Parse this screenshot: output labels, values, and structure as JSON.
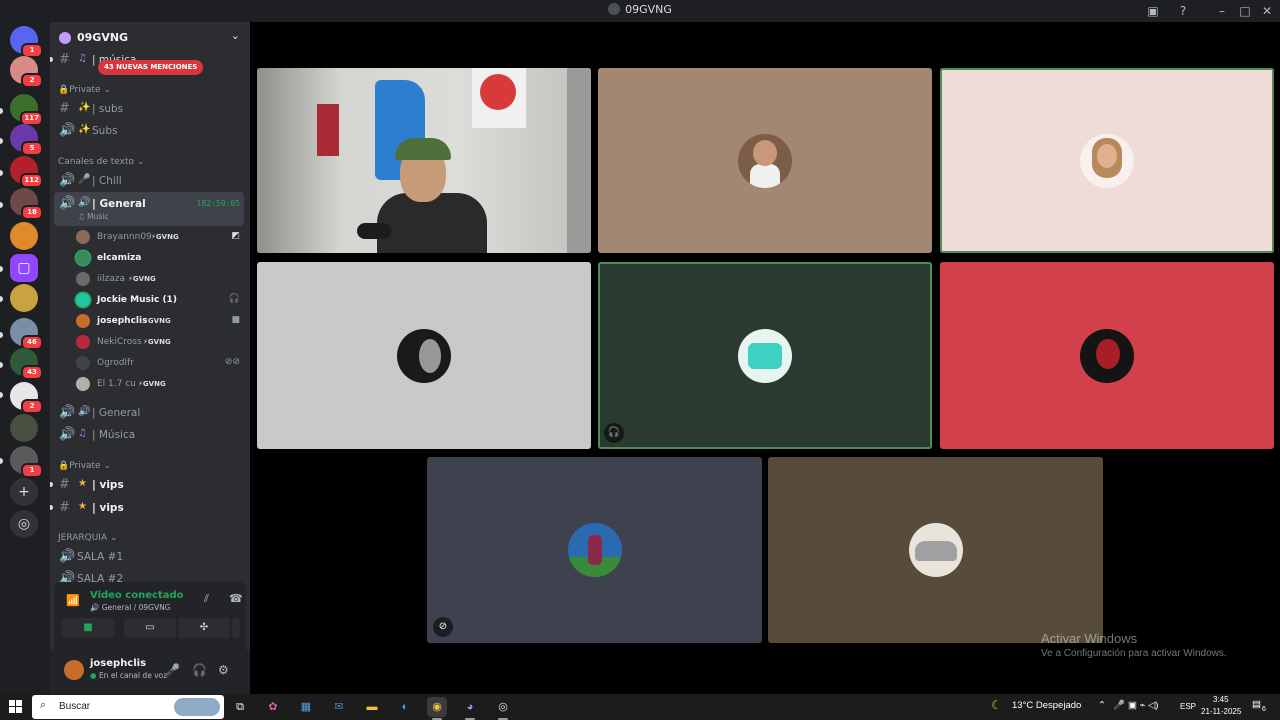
{
  "window": {
    "title": "09GVNG"
  },
  "colors": {
    "accent_green": "#23a55a",
    "mention_red": "#da373c",
    "rail_bg": "#1e1f22",
    "sidebar_bg": "#2b2d31"
  },
  "rail": {
    "badges": [
      "1",
      "2",
      "117",
      "5",
      "112",
      "18",
      "46",
      "43",
      "2",
      "1"
    ]
  },
  "guild": {
    "name": "09GVNG",
    "mention_banner": "43 NUEVAS MENCIONES",
    "partial_channel": "música",
    "categories": {
      "private1": "Private",
      "text": "Canales de texto",
      "private2": "Private",
      "jerarquia": "JERARQUIA"
    },
    "channels": {
      "subs_text": "| subs",
      "subs_voice": "Subs",
      "chill": "| Chill",
      "general": "| General",
      "general_timer": "182:59:05",
      "general_status": "Music",
      "general1": "| General",
      "musica": "| Música",
      "vips1": "| vips",
      "vips2": "| vips",
      "sala1": "SALA #1",
      "sala2": "SALA #2"
    },
    "members": [
      {
        "name": "Brayannn09",
        "tag": "GVNG"
      },
      {
        "name": "elcamiza",
        "tag": ""
      },
      {
        "name": "iilzaza",
        "tag": "GVNG"
      },
      {
        "name": "Jockie Music (1)",
        "tag": ""
      },
      {
        "name": "josephclis",
        "tag": "GVNG"
      },
      {
        "name": "NekiCross",
        "tag": "GVNG"
      },
      {
        "name": "Ogrodlfr",
        "tag": ""
      },
      {
        "name": "El 1.7 cu",
        "tag": "GVNG"
      }
    ]
  },
  "voice_panel": {
    "status": "Video conectado",
    "location": "General / 09GVNG"
  },
  "user_panel": {
    "name": "josephclis",
    "status": "En el canal de voz"
  },
  "watermark": {
    "line1": "Activar Windows",
    "line2": "Ve a Configuración para activar Windows."
  },
  "taskbar": {
    "search_placeholder": "Buscar",
    "weather": "13°C  Despejado",
    "language": "ESP",
    "time": "3:45",
    "date": "21-11-2025",
    "notifications": "6"
  }
}
